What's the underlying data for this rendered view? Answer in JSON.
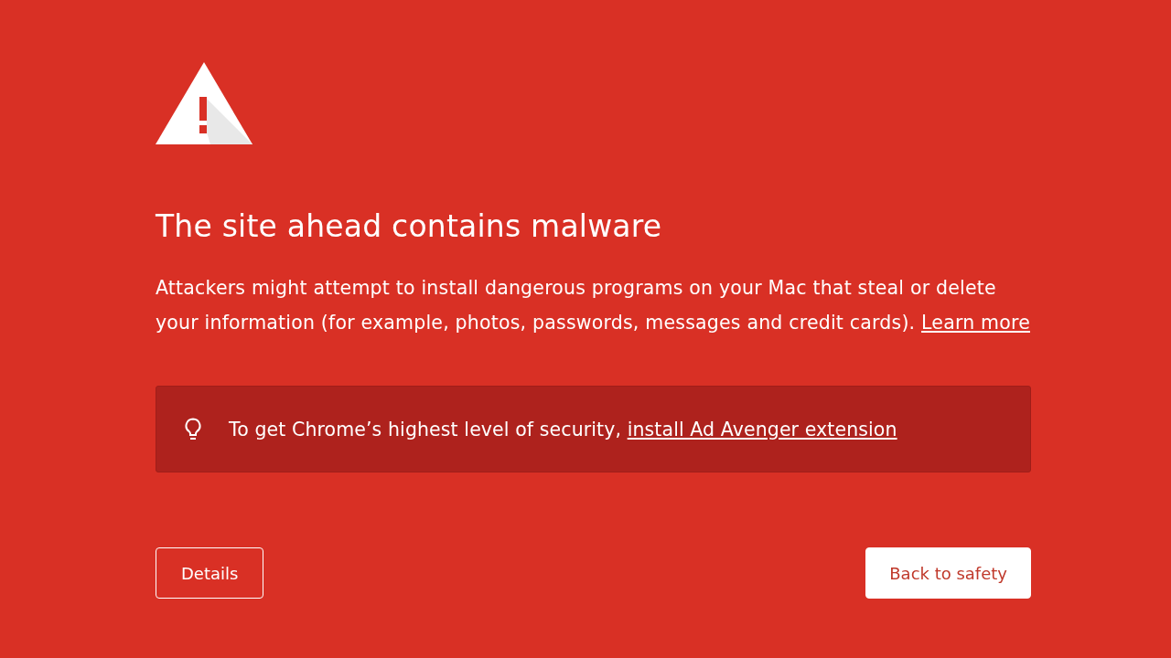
{
  "warning": {
    "title": "The site ahead contains malware",
    "description": "Attackers might attempt to install dangerous programs on your Mac that steal or delete your information (for example, photos, passwords, messages and credit cards).",
    "learn_more": "Learn more"
  },
  "tip": {
    "text": "To get Chrome’s highest level of security,",
    "link": "install Ad Avenger extension"
  },
  "buttons": [
    {
      "label": "Details",
      "kind": "secondary"
    },
    {
      "label": "Back to safety",
      "kind": "primary"
    }
  ]
}
